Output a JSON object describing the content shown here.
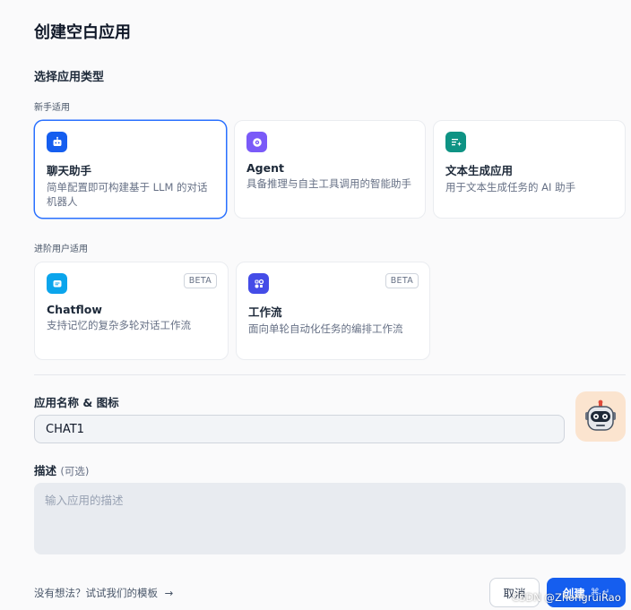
{
  "dialog": {
    "title": "创建空白应用",
    "type_section_title": "选择应用类型",
    "beginner_label": "新手适用",
    "advanced_label": "进阶用户适用"
  },
  "app_types_beginner": [
    {
      "name": "聊天助手",
      "desc": "简单配置即可构建基于 LLM 的对话机器人",
      "icon": "robot-chat-icon",
      "color": "#155eef",
      "selected": true
    },
    {
      "name": "Agent",
      "desc": "具备推理与自主工具调用的智能助手",
      "icon": "agent-brain-icon",
      "color": "#7a5af8"
    },
    {
      "name": "文本生成应用",
      "desc": "用于文本生成任务的 AI 助手",
      "icon": "text-generate-icon",
      "color": "#0e9384"
    }
  ],
  "app_types_advanced": [
    {
      "name": "Chatflow",
      "desc": "支持记忆的复杂多轮对话工作流",
      "icon": "chatflow-icon",
      "color": "#0ba5ec",
      "badge": "BETA"
    },
    {
      "name": "工作流",
      "desc": "面向单轮自动化任务的编排工作流",
      "icon": "workflow-icon",
      "color": "#444ce7",
      "badge": "BETA"
    }
  ],
  "form": {
    "name_label": "应用名称 & 图标",
    "name_value": "CHAT1",
    "desc_label": "描述",
    "desc_optional": "(可选)",
    "desc_placeholder": "输入应用的描述"
  },
  "footer": {
    "template_link": "没有想法？试试我们的模板",
    "arrow": "→",
    "cancel": "取消",
    "create": "创建",
    "create_shortcut": "⌘ ↵"
  },
  "watermark": "CSDN @ZhongruiRao"
}
